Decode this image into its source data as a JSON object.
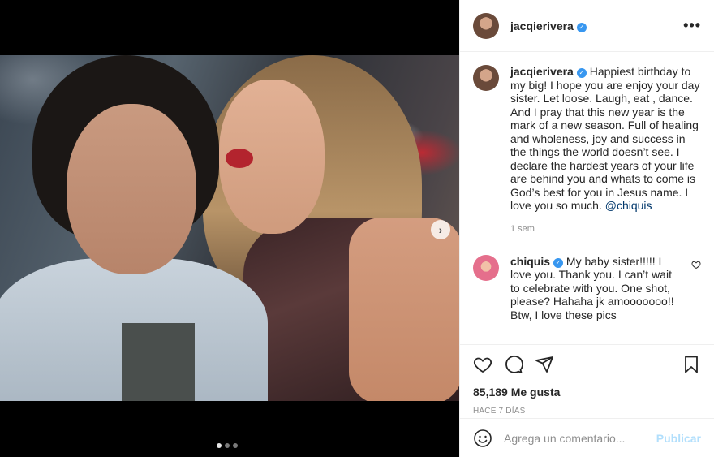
{
  "post": {
    "author": "jacqierivera",
    "more_icon": "more-horizontal-icon",
    "caption_text": "Happiest birthday to my big! I hope you are enjoy your day sister. Let loose. Laugh, eat , dance. And I pray that this new year is the mark of a new season. Full of healing and wholeness, joy and success in the things the world doesn’t see. I declare the hardest years of your life are behind you and whats to come is God’s best for you in Jesus name. I love you so much.",
    "caption_mention": "@chiquis",
    "caption_time": "1 sem",
    "comment": {
      "author": "chiquis",
      "text": "My baby sister!!!!! I love you. Thank you. I can’t wait to celebrate with you. One shot, please? Hahaha jk amooooooo!! Btw, I love these pics"
    },
    "likes": "85,189 Me gusta",
    "date": "HACE 7 DÍAS",
    "input_placeholder": "Agrega un comentario...",
    "post_label": "Publicar"
  },
  "carousel": {
    "current": 1,
    "total": 3
  },
  "colors": {
    "verified": "#3897f0",
    "mention": "#00376b",
    "post_button": "#b2dffc",
    "muted": "#8e8e8e"
  }
}
